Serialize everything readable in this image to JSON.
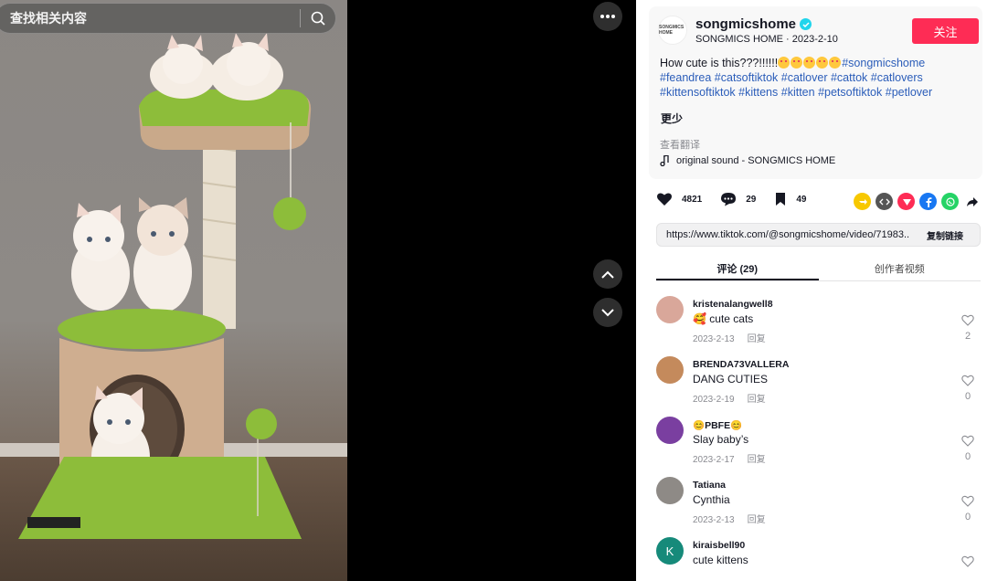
{
  "search": {
    "placeholder": "查找相关内容"
  },
  "post": {
    "author": "songmicshome",
    "brand_logo_text": "SONGMICS HOME",
    "author_subtitle": "SONGMICS HOME · 2023-2-10",
    "follow_label": "关注",
    "caption_text": "How cute is this???!!!!!!",
    "caption_emoji_count": 5,
    "hashtags": [
      "#songmicshome",
      "#feandrea",
      "#catsoftiktok",
      "#catlover",
      "#cattok",
      "#catlovers",
      "#kittensoftiktok",
      "#kittens",
      "#kitten",
      "#petsoftiktok",
      "#petlover"
    ],
    "less_label": "更少",
    "translate_label": "查看翻译",
    "sound": "original sound - SONGMICS HOME"
  },
  "actions": {
    "likes": "4821",
    "comments": "29",
    "saves": "49"
  },
  "share_icons": [
    {
      "name": "repost-icon",
      "color": "#f7c800"
    },
    {
      "name": "embed-icon",
      "color": "#555555"
    },
    {
      "name": "send-icon",
      "color": "#fe2c55"
    },
    {
      "name": "facebook-icon",
      "color": "#1877f2"
    },
    {
      "name": "whatsapp-icon",
      "color": "#25d366"
    },
    {
      "name": "share-arrow-icon",
      "color": "#161823"
    }
  ],
  "link": {
    "url": "https://www.tiktok.com/@songmicshome/video/71983...",
    "copy_label": "复制链接"
  },
  "tabs": [
    {
      "label": "评论 (29)",
      "active": true
    },
    {
      "label": "创作者视频",
      "active": false
    }
  ],
  "reply_label": "回复",
  "comments": [
    {
      "user": "kristenalangwell8",
      "text": "🥰 cute cats",
      "date": "2023-2-13",
      "likes": "2",
      "avatar_color": "#d9a79a"
    },
    {
      "user": "BRENDA73VALLERA",
      "text": "DANG CUTIES",
      "date": "2023-2-19",
      "likes": "0",
      "avatar_color": "#c48a5c"
    },
    {
      "user": "😊PBFE😊",
      "text": "Slay baby’s",
      "date": "2023-2-17",
      "likes": "0",
      "avatar_color": "#7a3fa0"
    },
    {
      "user": "Tatiana",
      "text": "Cynthia",
      "date": "2023-2-13",
      "likes": "0",
      "avatar_color": "#8e8a86"
    },
    {
      "user": "kiraisbell90",
      "text": "cute kittens",
      "date": "",
      "likes": "",
      "avatar_color": "#168a7a",
      "avatar_letter": "K"
    }
  ]
}
